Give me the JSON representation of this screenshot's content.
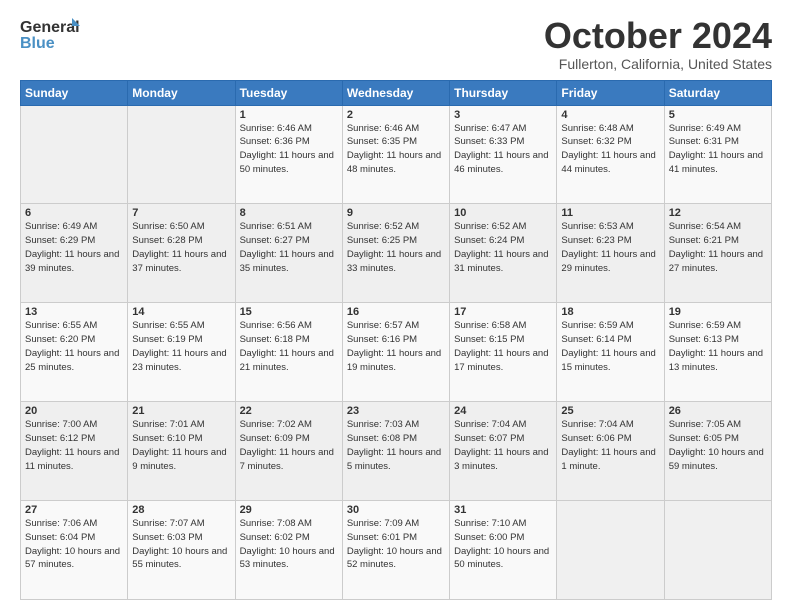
{
  "header": {
    "logo_line1": "General",
    "logo_line2": "Blue",
    "month": "October 2024",
    "location": "Fullerton, California, United States"
  },
  "weekdays": [
    "Sunday",
    "Monday",
    "Tuesday",
    "Wednesday",
    "Thursday",
    "Friday",
    "Saturday"
  ],
  "weeks": [
    [
      {
        "day": "",
        "content": ""
      },
      {
        "day": "",
        "content": ""
      },
      {
        "day": "1",
        "content": "Sunrise: 6:46 AM\nSunset: 6:36 PM\nDaylight: 11 hours and 50 minutes."
      },
      {
        "day": "2",
        "content": "Sunrise: 6:46 AM\nSunset: 6:35 PM\nDaylight: 11 hours and 48 minutes."
      },
      {
        "day": "3",
        "content": "Sunrise: 6:47 AM\nSunset: 6:33 PM\nDaylight: 11 hours and 46 minutes."
      },
      {
        "day": "4",
        "content": "Sunrise: 6:48 AM\nSunset: 6:32 PM\nDaylight: 11 hours and 44 minutes."
      },
      {
        "day": "5",
        "content": "Sunrise: 6:49 AM\nSunset: 6:31 PM\nDaylight: 11 hours and 41 minutes."
      }
    ],
    [
      {
        "day": "6",
        "content": "Sunrise: 6:49 AM\nSunset: 6:29 PM\nDaylight: 11 hours and 39 minutes."
      },
      {
        "day": "7",
        "content": "Sunrise: 6:50 AM\nSunset: 6:28 PM\nDaylight: 11 hours and 37 minutes."
      },
      {
        "day": "8",
        "content": "Sunrise: 6:51 AM\nSunset: 6:27 PM\nDaylight: 11 hours and 35 minutes."
      },
      {
        "day": "9",
        "content": "Sunrise: 6:52 AM\nSunset: 6:25 PM\nDaylight: 11 hours and 33 minutes."
      },
      {
        "day": "10",
        "content": "Sunrise: 6:52 AM\nSunset: 6:24 PM\nDaylight: 11 hours and 31 minutes."
      },
      {
        "day": "11",
        "content": "Sunrise: 6:53 AM\nSunset: 6:23 PM\nDaylight: 11 hours and 29 minutes."
      },
      {
        "day": "12",
        "content": "Sunrise: 6:54 AM\nSunset: 6:21 PM\nDaylight: 11 hours and 27 minutes."
      }
    ],
    [
      {
        "day": "13",
        "content": "Sunrise: 6:55 AM\nSunset: 6:20 PM\nDaylight: 11 hours and 25 minutes."
      },
      {
        "day": "14",
        "content": "Sunrise: 6:55 AM\nSunset: 6:19 PM\nDaylight: 11 hours and 23 minutes."
      },
      {
        "day": "15",
        "content": "Sunrise: 6:56 AM\nSunset: 6:18 PM\nDaylight: 11 hours and 21 minutes."
      },
      {
        "day": "16",
        "content": "Sunrise: 6:57 AM\nSunset: 6:16 PM\nDaylight: 11 hours and 19 minutes."
      },
      {
        "day": "17",
        "content": "Sunrise: 6:58 AM\nSunset: 6:15 PM\nDaylight: 11 hours and 17 minutes."
      },
      {
        "day": "18",
        "content": "Sunrise: 6:59 AM\nSunset: 6:14 PM\nDaylight: 11 hours and 15 minutes."
      },
      {
        "day": "19",
        "content": "Sunrise: 6:59 AM\nSunset: 6:13 PM\nDaylight: 11 hours and 13 minutes."
      }
    ],
    [
      {
        "day": "20",
        "content": "Sunrise: 7:00 AM\nSunset: 6:12 PM\nDaylight: 11 hours and 11 minutes."
      },
      {
        "day": "21",
        "content": "Sunrise: 7:01 AM\nSunset: 6:10 PM\nDaylight: 11 hours and 9 minutes."
      },
      {
        "day": "22",
        "content": "Sunrise: 7:02 AM\nSunset: 6:09 PM\nDaylight: 11 hours and 7 minutes."
      },
      {
        "day": "23",
        "content": "Sunrise: 7:03 AM\nSunset: 6:08 PM\nDaylight: 11 hours and 5 minutes."
      },
      {
        "day": "24",
        "content": "Sunrise: 7:04 AM\nSunset: 6:07 PM\nDaylight: 11 hours and 3 minutes."
      },
      {
        "day": "25",
        "content": "Sunrise: 7:04 AM\nSunset: 6:06 PM\nDaylight: 11 hours and 1 minute."
      },
      {
        "day": "26",
        "content": "Sunrise: 7:05 AM\nSunset: 6:05 PM\nDaylight: 10 hours and 59 minutes."
      }
    ],
    [
      {
        "day": "27",
        "content": "Sunrise: 7:06 AM\nSunset: 6:04 PM\nDaylight: 10 hours and 57 minutes."
      },
      {
        "day": "28",
        "content": "Sunrise: 7:07 AM\nSunset: 6:03 PM\nDaylight: 10 hours and 55 minutes."
      },
      {
        "day": "29",
        "content": "Sunrise: 7:08 AM\nSunset: 6:02 PM\nDaylight: 10 hours and 53 minutes."
      },
      {
        "day": "30",
        "content": "Sunrise: 7:09 AM\nSunset: 6:01 PM\nDaylight: 10 hours and 52 minutes."
      },
      {
        "day": "31",
        "content": "Sunrise: 7:10 AM\nSunset: 6:00 PM\nDaylight: 10 hours and 50 minutes."
      },
      {
        "day": "",
        "content": ""
      },
      {
        "day": "",
        "content": ""
      }
    ]
  ]
}
